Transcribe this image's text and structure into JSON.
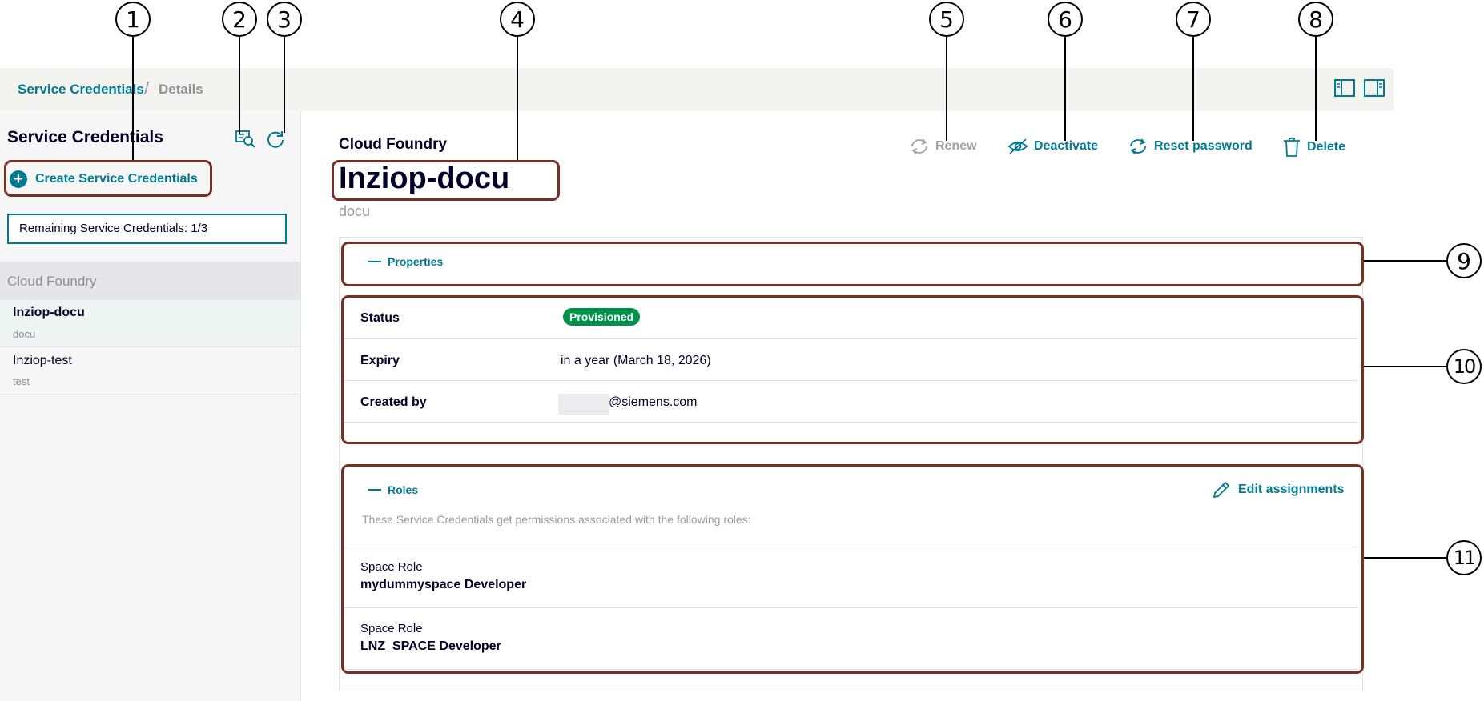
{
  "breadcrumb": {
    "link": "Service Credentials",
    "separator": "/",
    "current": "Details"
  },
  "topbar_icons": [
    "layout-left-panel-icon",
    "layout-right-panel-icon"
  ],
  "sidebar": {
    "title": "Service Credentials",
    "create_button": "Create Service Credentials",
    "remaining": "Remaining Service Credentials: 1/3",
    "group_label": "Cloud Foundry",
    "items": [
      {
        "title": "Inziop-docu",
        "subtitle": "docu",
        "selected": true
      },
      {
        "title": "Inziop-test",
        "subtitle": "test",
        "selected": false
      }
    ]
  },
  "main": {
    "subtitle": "Cloud Foundry",
    "title": "Inziop-docu",
    "description": "docu",
    "actions": {
      "renew": "Renew",
      "deactivate": "Deactivate",
      "reset_password": "Reset password",
      "delete": "Delete"
    },
    "properties": {
      "toggle_label": "Properties",
      "rows": [
        {
          "label": "Status",
          "value": "Provisioned"
        },
        {
          "label": "Expiry",
          "value": "in a year (March 18, 2026)"
        },
        {
          "label": "Created by",
          "value": "@siemens.com"
        }
      ]
    },
    "roles": {
      "toggle_label": "Roles",
      "edit_label": "Edit assignments",
      "description": "These Service Credentials get permissions associated with the following roles:",
      "items": [
        {
          "type": "Space Role",
          "name": "mydummyspace Developer"
        },
        {
          "type": "Space Role",
          "name": "LNZ_SPACE Developer"
        }
      ]
    }
  },
  "callouts": [
    "1",
    "2",
    "3",
    "4",
    "5",
    "6",
    "7",
    "8",
    "9",
    "10",
    "11"
  ],
  "colors": {
    "accent": "#007993",
    "success": "#00924a",
    "highlight": "#7b2e22",
    "text": "#000028"
  }
}
